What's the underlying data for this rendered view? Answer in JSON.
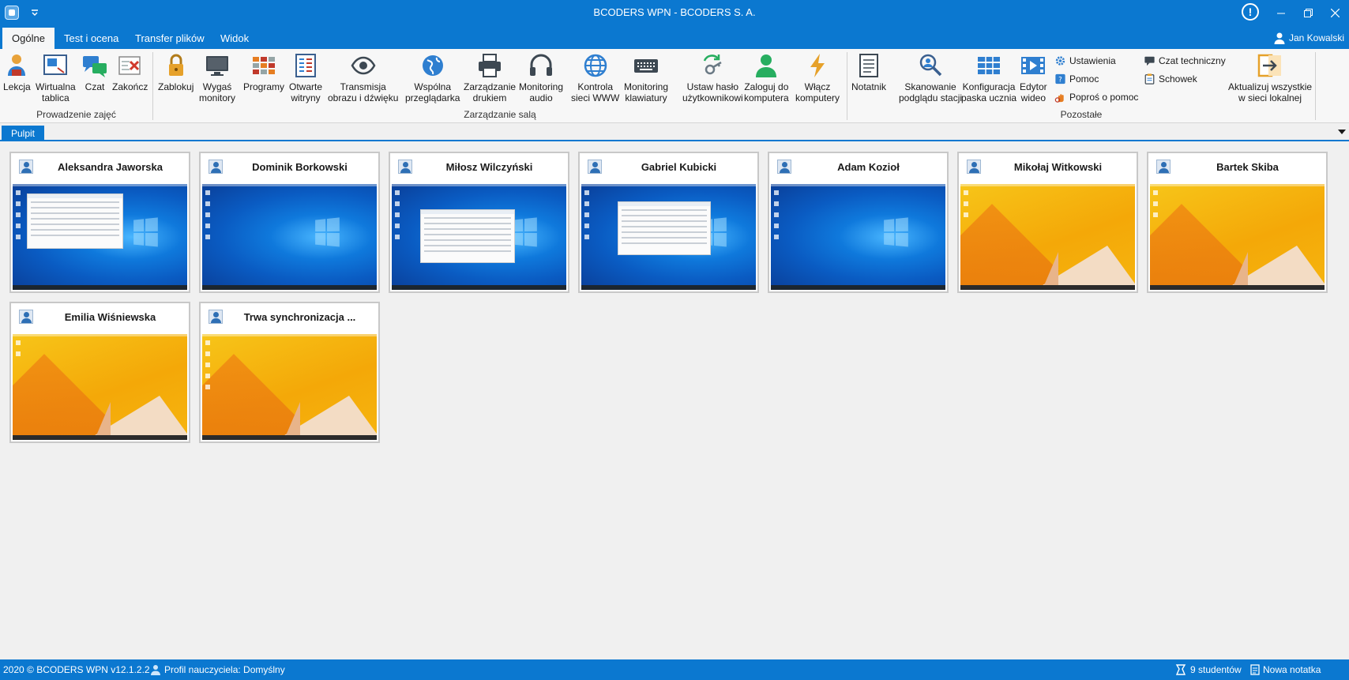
{
  "window": {
    "title": "BCODERS WPN - BCODERS S. A.",
    "icons": [
      "app-icon",
      "quick-access-arrow-icon",
      "alert-icon",
      "minimize-icon",
      "restore-icon",
      "close-icon"
    ]
  },
  "tabs": [
    {
      "label": "Ogólne",
      "active": true
    },
    {
      "label": "Test i ocena",
      "active": false
    },
    {
      "label": "Transfer plików",
      "active": false
    },
    {
      "label": "Widok",
      "active": false
    }
  ],
  "user": {
    "name": "Jan Kowalski"
  },
  "ribbon": {
    "groups": {
      "prowadzenie": "Prowadzenie zajęć",
      "zarzadzanie": "Zarządzanie salą",
      "pozostale": "Pozostałe"
    },
    "buttons": {
      "lekcja": "Lekcja",
      "tablica": "Wirtualna\ntablica",
      "czat": "Czat",
      "zakoncz": "Zakończ",
      "zablokuj": "Zablokuj",
      "wygas": "Wygaś\nmonitory",
      "programy": "Programy",
      "witryny": "Otwarte\nwitryny",
      "transmisja": "Transmisja\nobrazu i dźwięku",
      "przegladarka": "Wspólna\nprzeglądarka",
      "druk": "Zarządzanie\ndrukiem",
      "audio": "Monitoring\naudio",
      "www": "Kontrola\nsieci WWW",
      "klawiatura": "Monitoring\nklawiatury",
      "haslo": "Ustaw hasło\nużytkownikowi",
      "zaloguj": "Zaloguj do\nkomputera",
      "wlacz": "Włącz\nkomputery",
      "notatnik": "Notatnik",
      "skanowanie": "Skanowanie\npodglądu stacji",
      "konfiguracja": "Konfiguracja\npaska ucznia",
      "edytor": "Edytor\nwideo",
      "aktualizuj": "Aktualizuj wszystkie\nw sieci lokalnej"
    },
    "small_buttons": {
      "ustawienia": "Ustawienia",
      "pomoc": "Pomoc",
      "popros": "Poproś o pomoc",
      "czat_techniczny": "Czat techniczny",
      "schowek": "Schowek"
    }
  },
  "document_tab": {
    "label": "Pulpit"
  },
  "students": [
    {
      "name": "Aleksandra Jaworska",
      "desktop": "win10",
      "window": "explorer"
    },
    {
      "name": "Dominik Borkowski",
      "desktop": "win10",
      "window": "none"
    },
    {
      "name": "Miłosz Wilczyński",
      "desktop": "win10",
      "window": "dialog"
    },
    {
      "name": "Gabriel Kubicki",
      "desktop": "win10",
      "window": "dialog"
    },
    {
      "name": "Adam Kozioł",
      "desktop": "win10",
      "window": "none"
    },
    {
      "name": "Mikołaj Witkowski",
      "desktop": "win8",
      "window": "none"
    },
    {
      "name": "Bartek Skiba",
      "desktop": "win8",
      "window": "none"
    },
    {
      "name": "Emilia Wiśniewska",
      "desktop": "win8",
      "window": "none"
    },
    {
      "name": "Trwa synchronizacja ...",
      "desktop": "win8",
      "window": "none"
    }
  ],
  "statusbar": {
    "copyright": "2020 ©  BCODERS WPN v12.1.2.2",
    "profile": "Profil nauczyciela: Domyślny",
    "students_count": "9 studentów",
    "new_note": "Nowa notatka"
  },
  "colors": {
    "accent": "#0b78d0",
    "ribbon_bg": "#f7f7f7",
    "workspace_bg": "#f0f0f0"
  }
}
